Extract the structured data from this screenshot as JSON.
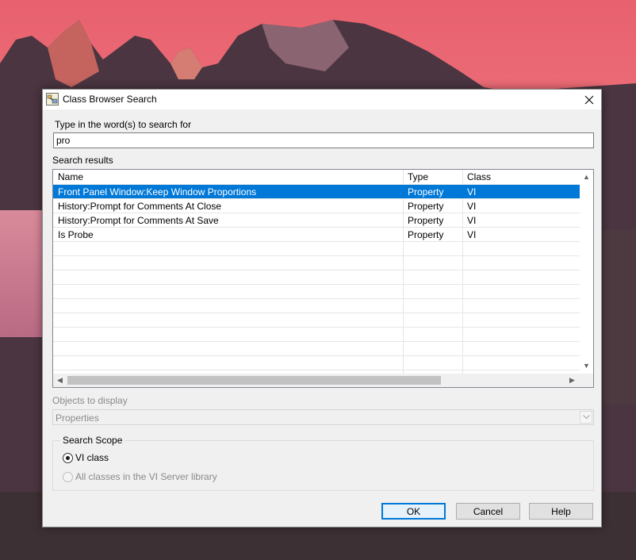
{
  "dialog": {
    "title": "Class Browser Search",
    "search_label": "Type in the word(s) to search for",
    "search_value": "pro",
    "results_label": "Search results",
    "columns": {
      "name": "Name",
      "type": "Type",
      "class": "Class"
    },
    "rows": [
      {
        "name": "Front Panel Window:Keep Window Proportions",
        "type": "Property",
        "class": "VI",
        "selected": true
      },
      {
        "name": "History:Prompt for Comments At Close",
        "type": "Property",
        "class": "VI",
        "selected": false
      },
      {
        "name": "History:Prompt for Comments At Save",
        "type": "Property",
        "class": "VI",
        "selected": false
      },
      {
        "name": "Is Probe",
        "type": "Property",
        "class": "VI",
        "selected": false
      }
    ],
    "objects_label": "Objects to display",
    "objects_value": "Properties",
    "scope": {
      "title": "Search Scope",
      "option_vi_class": "VI class",
      "option_all_classes": "All classes in the VI Server library",
      "selected": "VI class"
    },
    "buttons": {
      "ok": "OK",
      "cancel": "Cancel",
      "help": "Help"
    }
  },
  "colors": {
    "selection": "#0078d7",
    "dialog_bg": "#f0f0f0",
    "default_button_border": "#0078d7"
  },
  "icons": [
    "class-browser-icon",
    "close-icon",
    "scroll-up-icon",
    "scroll-down-icon",
    "scroll-left-icon",
    "scroll-right-icon",
    "chevron-down-icon"
  ]
}
